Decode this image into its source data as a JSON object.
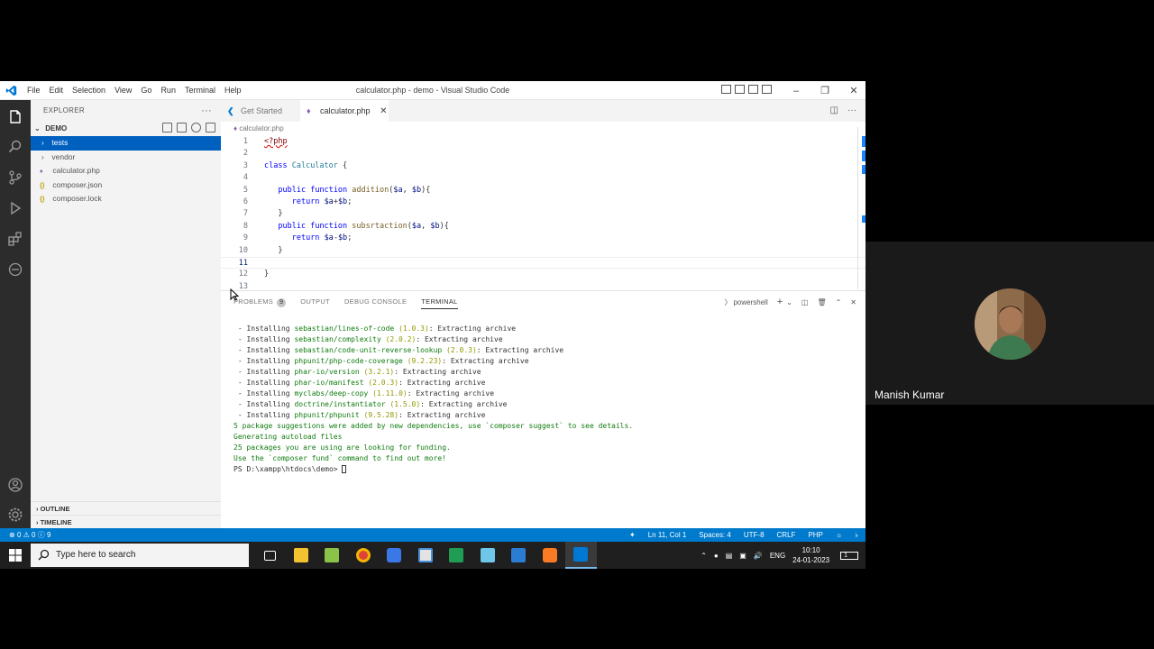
{
  "window": {
    "title": "calculator.php - demo - Visual Studio Code",
    "menu": [
      "File",
      "Edit",
      "Selection",
      "View",
      "Go",
      "Run",
      "Terminal",
      "Help"
    ]
  },
  "sidebar": {
    "header": "EXPLORER",
    "folder": "DEMO",
    "items": [
      {
        "label": "tests",
        "type": "folder",
        "selected": true
      },
      {
        "label": "vendor",
        "type": "folder",
        "selected": false
      },
      {
        "label": "calculator.php",
        "type": "php",
        "selected": false
      },
      {
        "label": "composer.json",
        "type": "json",
        "selected": false
      },
      {
        "label": "composer.lock",
        "type": "json",
        "selected": false
      }
    ],
    "outline": "OUTLINE",
    "timeline": "TIMELINE"
  },
  "tabs": [
    {
      "label": "Get Started",
      "active": false
    },
    {
      "label": "calculator.php",
      "active": true
    }
  ],
  "breadcrumb": "calculator.php",
  "code": {
    "line_numbers": [
      "1",
      "2",
      "3",
      "4",
      "5",
      "6",
      "7",
      "8",
      "9",
      "10",
      "11",
      "12",
      "13"
    ]
  },
  "panel": {
    "tabs": [
      "PROBLEMS",
      "OUTPUT",
      "DEBUG CONSOLE",
      "TERMINAL"
    ],
    "problems_count": "9",
    "shell": "powershell",
    "installs": [
      {
        "pkg": "sebastian/lines-of-code",
        "ver": "(1.0.3)"
      },
      {
        "pkg": "sebastian/complexity",
        "ver": "(2.0.2)"
      },
      {
        "pkg": "sebastian/code-unit-reverse-lookup",
        "ver": "(2.0.3)"
      },
      {
        "pkg": "phpunit/php-code-coverage",
        "ver": "(9.2.23)"
      },
      {
        "pkg": "phar-io/version",
        "ver": "(3.2.1)"
      },
      {
        "pkg": "phar-io/manifest",
        "ver": "(2.0.3)"
      },
      {
        "pkg": "myclabs/deep-copy",
        "ver": "(1.11.0)"
      },
      {
        "pkg": "doctrine/instantiator",
        "ver": "(1.5.0)"
      },
      {
        "pkg": "phpunit/phpunit",
        "ver": "(9.5.28)"
      }
    ],
    "install_prefix": "- Installing",
    "install_suffix": ": Extracting archive",
    "messages": [
      "5 package suggestions were added by new dependencies, use `composer suggest` to see details.",
      "Generating autoload files",
      "25 packages you are using are looking for funding.",
      "Use the `composer fund` command to find out more!"
    ],
    "prompt": "PS D:\\xampp\\htdocs\\demo> "
  },
  "statusbar": {
    "errors": "0",
    "warnings": "0",
    "info": "9",
    "position": "Ln 11, Col 1",
    "spaces": "Spaces: 4",
    "encoding": "UTF-8",
    "eol": "CRLF",
    "language": "PHP"
  },
  "taskbar": {
    "search_placeholder": "Type here to search",
    "lang": "ENG",
    "time": "10:10",
    "date": "24-01-2023",
    "notifications": "1"
  },
  "participant": {
    "name": "Manish Kumar"
  },
  "colors": {
    "accent": "#007acc",
    "selection": "#0060c0",
    "activitybar": "#2c2c2c"
  }
}
